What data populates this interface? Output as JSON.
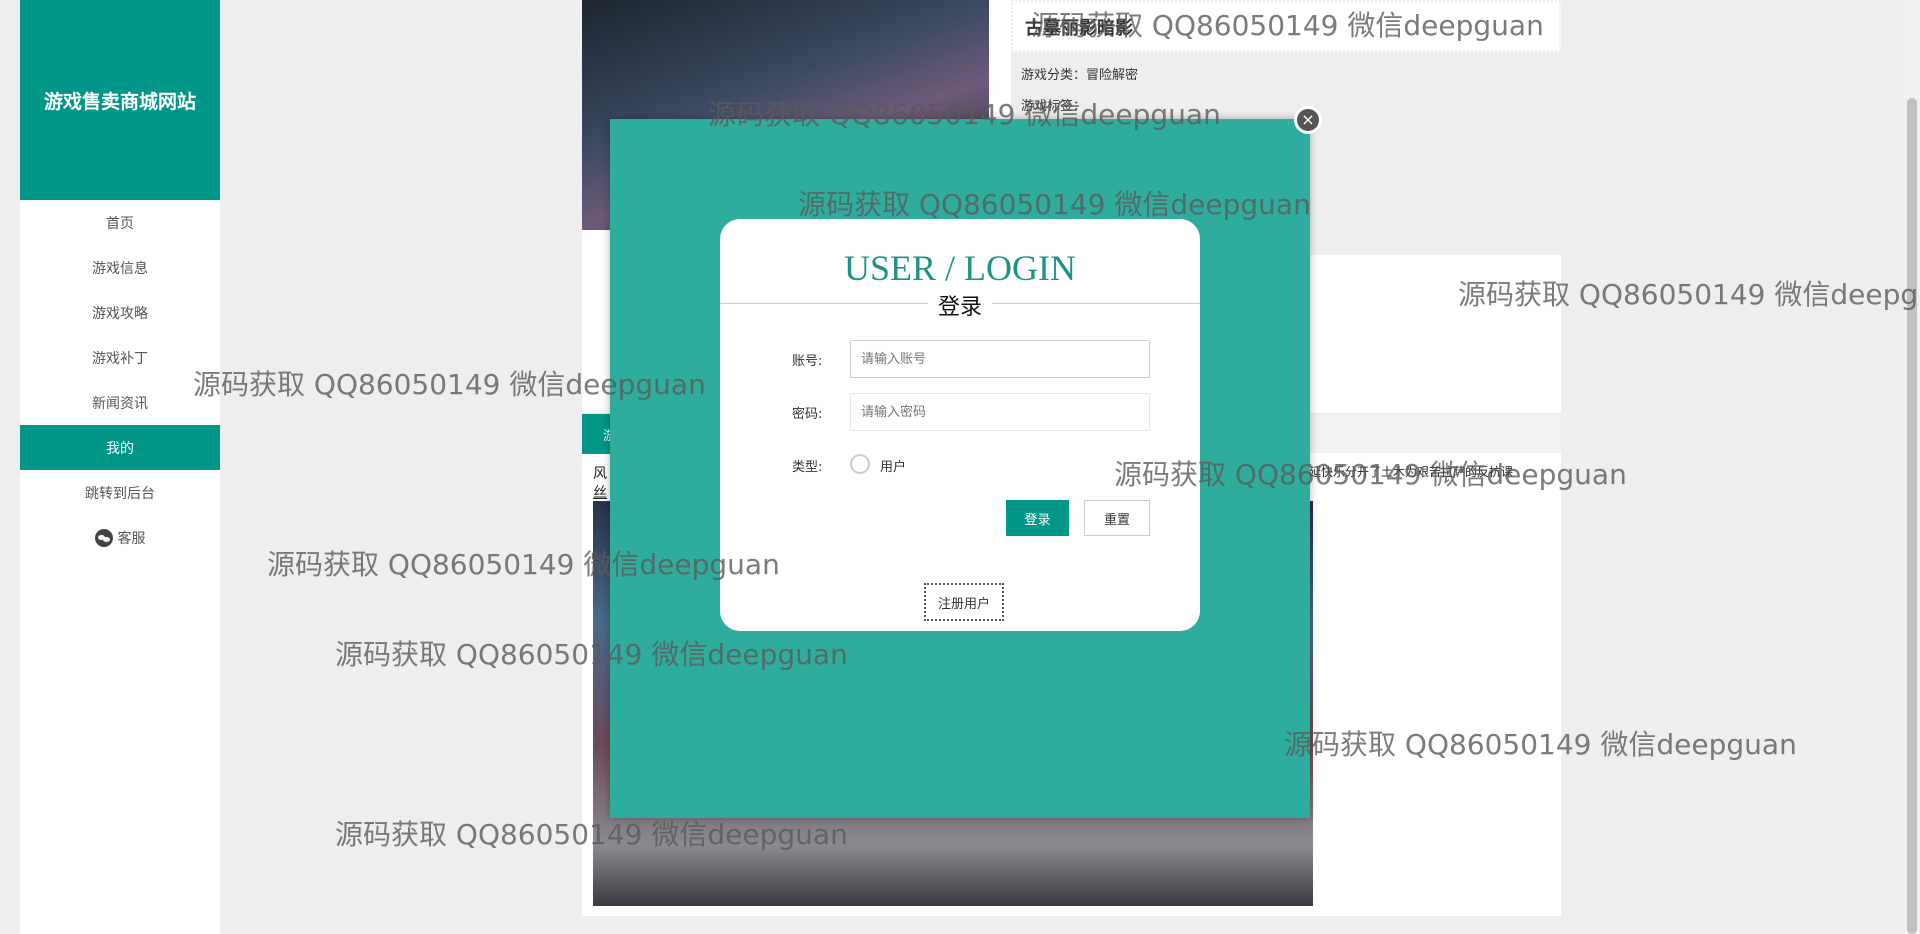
{
  "sidebar": {
    "brand": "游戏售卖商城网站",
    "items": [
      {
        "label": "首页"
      },
      {
        "label": "游戏信息"
      },
      {
        "label": "游戏攻略"
      },
      {
        "label": "游戏补丁"
      },
      {
        "label": "新闻资讯"
      },
      {
        "label": "我的",
        "active": true
      },
      {
        "label": "跳转到后台"
      },
      {
        "label": "客服",
        "icon": "wechat-icon"
      }
    ]
  },
  "detail": {
    "title": "古墓丽影暗影",
    "category_label": "游戏分类：",
    "category": "冒险解密",
    "tag_label": "游戏标签："
  },
  "section": {
    "tab": "游",
    "left_snip_1": "风",
    "left_snip_2": "丝",
    "right_snip": "延快乐分开了土木为艰苦拉萨的反抗课"
  },
  "modal": {
    "close": "×",
    "title": "USER / LOGIN",
    "subtitle": "登录",
    "account_label": "账号:",
    "account_placeholder": "请输入账号",
    "account_value": "",
    "password_label": "密码:",
    "password_placeholder": "请输入密码",
    "type_label": "类型:",
    "type_option": "用户",
    "login_button": "登录",
    "reset_button": "重置",
    "register_button": "注册用户"
  },
  "watermark": "源码获取 QQ86050149 微信deepguan",
  "colors": {
    "primary": "#009688",
    "modal_bg": "#2ead9f"
  }
}
